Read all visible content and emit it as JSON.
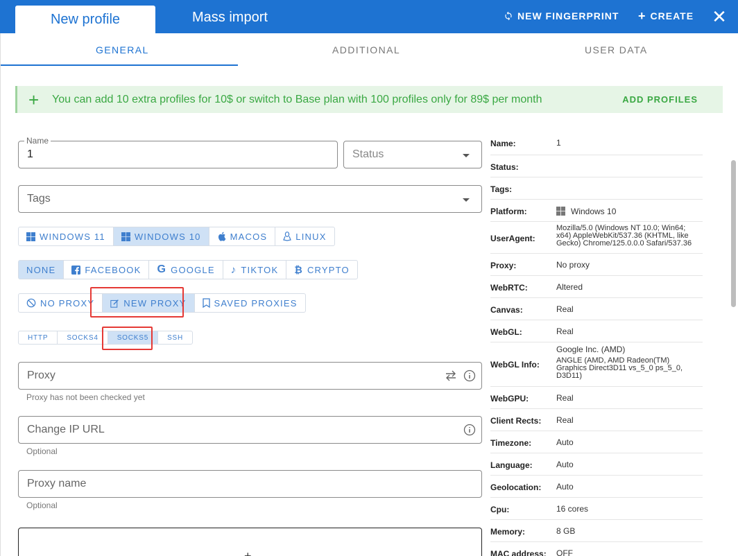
{
  "header": {
    "tab_new_profile": "New profile",
    "tab_mass_import": "Mass import",
    "new_fingerprint": "NEW FINGERPRINT",
    "create": "CREATE"
  },
  "subtabs": [
    "GENERAL",
    "ADDITIONAL",
    "USER DATA"
  ],
  "banner": {
    "message": "You can add 10 extra profiles for 10$ or switch to Base plan with 100 profiles only for 89$ per month",
    "action": "ADD PROFILES"
  },
  "form": {
    "name_label": "Name",
    "name_value": "1",
    "status_placeholder": "Status",
    "tags_placeholder": "Tags",
    "proxy_placeholder": "Proxy",
    "proxy_hint": "Proxy has not been checked yet",
    "change_ip_placeholder": "Change IP URL",
    "change_ip_hint": "Optional",
    "proxy_name_placeholder": "Proxy name",
    "proxy_name_hint": "Optional"
  },
  "os_buttons": [
    "WINDOWS 11",
    "WINDOWS 10",
    "MACOS",
    "LINUX"
  ],
  "os_selected": "WINDOWS 10",
  "template_buttons": [
    "NONE",
    "FACEBOOK",
    "GOOGLE",
    "TIKTOK",
    "CRYPTO"
  ],
  "template_selected": "NONE",
  "proxy_mode_buttons": [
    "NO PROXY",
    "NEW PROXY",
    "SAVED PROXIES"
  ],
  "proxy_mode_selected": "NEW PROXY",
  "proxy_type_buttons": [
    "HTTP",
    "SOCKS4",
    "SOCKS5",
    "SSH"
  ],
  "proxy_type_selected": "SOCKS5",
  "summary": [
    {
      "key": "Name:",
      "value": "1"
    },
    {
      "key": "Status:",
      "value": ""
    },
    {
      "key": "Tags:",
      "value": ""
    },
    {
      "key": "Platform:",
      "value": "Windows 10"
    },
    {
      "key": "UserAgent:",
      "value": "Mozilla/5.0 (Windows NT 10.0; Win64; x64) AppleWebKit/537.36 (KHTML, like Gecko) Chrome/125.0.0.0 Safari/537.36"
    },
    {
      "key": "Proxy:",
      "value": "No proxy"
    },
    {
      "key": "WebRTC:",
      "value": "Altered"
    },
    {
      "key": "Canvas:",
      "value": "Real"
    },
    {
      "key": "WebGL:",
      "value": "Real"
    },
    {
      "key": "WebGL Info:",
      "value": "Google Inc. (AMD)",
      "value2": "ANGLE (AMD, AMD Radeon(TM) Graphics Direct3D11 vs_5_0 ps_5_0, D3D11)"
    },
    {
      "key": "WebGPU:",
      "value": "Real"
    },
    {
      "key": "Client Rects:",
      "value": "Real"
    },
    {
      "key": "Timezone:",
      "value": "Auto"
    },
    {
      "key": "Language:",
      "value": "Auto"
    },
    {
      "key": "Geolocation:",
      "value": "Auto"
    },
    {
      "key": "Cpu:",
      "value": "16 cores"
    },
    {
      "key": "Memory:",
      "value": "8 GB"
    },
    {
      "key": "MAC address:",
      "value": "OFF"
    }
  ],
  "colors": {
    "primary": "#1e73d2",
    "success": "#3aa843",
    "highlight": "#e53935"
  }
}
